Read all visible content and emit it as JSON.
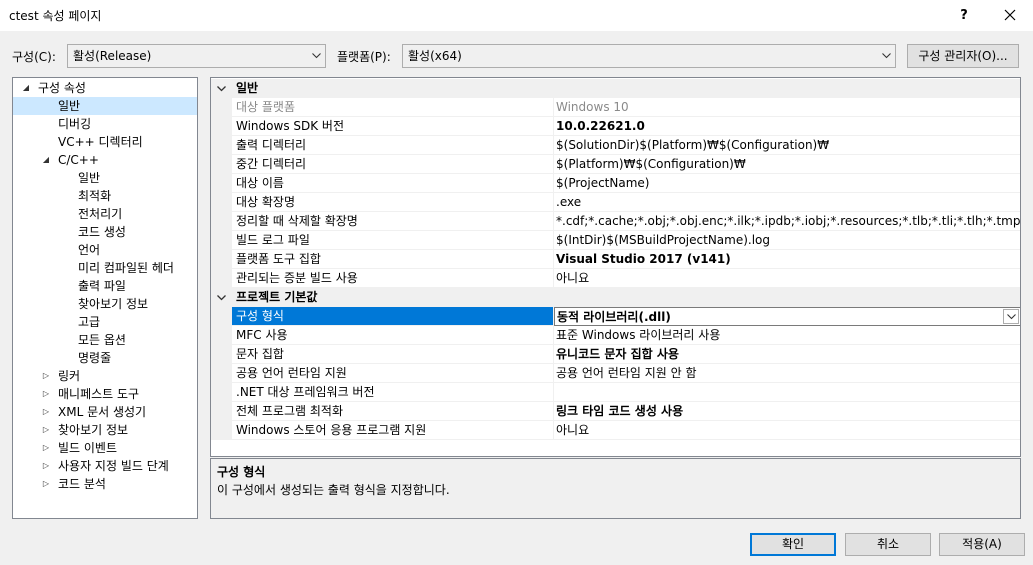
{
  "window": {
    "title": "ctest 속성 페이지",
    "help": "?",
    "close": "✕"
  },
  "top": {
    "config_label": "구성(C):",
    "config_value": "활성(Release)",
    "platform_label": "플랫폼(P):",
    "platform_value": "활성(x64)",
    "config_manager": "구성 관리자(O)..."
  },
  "tree": {
    "items": [
      {
        "label": "구성 속성"
      },
      {
        "label": "일반"
      },
      {
        "label": "디버깅"
      },
      {
        "label": "VC++ 디렉터리"
      },
      {
        "label": "C/C++"
      },
      {
        "label": "일반"
      },
      {
        "label": "최적화"
      },
      {
        "label": "전처리기"
      },
      {
        "label": "코드 생성"
      },
      {
        "label": "언어"
      },
      {
        "label": "미리 컴파일된 헤더"
      },
      {
        "label": "출력 파일"
      },
      {
        "label": "찾아보기 정보"
      },
      {
        "label": "고급"
      },
      {
        "label": "모든 옵션"
      },
      {
        "label": "명령줄"
      },
      {
        "label": "링커"
      },
      {
        "label": "매니페스트 도구"
      },
      {
        "label": "XML 문서 생성기"
      },
      {
        "label": "찾아보기 정보"
      },
      {
        "label": "빌드 이벤트"
      },
      {
        "label": "사용자 지정 빌드 단계"
      },
      {
        "label": "코드 분석"
      }
    ]
  },
  "grid": {
    "categories": [
      {
        "title": "일반"
      },
      {
        "title": "프로젝트 기본값"
      }
    ],
    "general": [
      {
        "name": "대상 플랫폼",
        "value": "Windows 10"
      },
      {
        "name": "Windows SDK 버전",
        "value": "10.0.22621.0"
      },
      {
        "name": "출력 디렉터리",
        "value": "$(SolutionDir)$(Platform)₩$(Configuration)₩"
      },
      {
        "name": "중간 디렉터리",
        "value": "$(Platform)₩$(Configuration)₩"
      },
      {
        "name": "대상 이름",
        "value": "$(ProjectName)"
      },
      {
        "name": "대상 확장명",
        "value": ".exe"
      },
      {
        "name": "정리할 때 삭제할 확장명",
        "value": "*.cdf;*.cache;*.obj;*.obj.enc;*.ilk;*.ipdb;*.iobj;*.resources;*.tlb;*.tli;*.tlh;*.tmp;*.rsp;*.pgc;*.pgd;*.meta"
      },
      {
        "name": "빌드 로그 파일",
        "value": "$(IntDir)$(MSBuildProjectName).log"
      },
      {
        "name": "플랫폼 도구 집합",
        "value": "Visual Studio 2017 (v141)"
      },
      {
        "name": "관리되는 증분 빌드 사용",
        "value": "아니요"
      }
    ],
    "defaults": [
      {
        "name": "구성 형식",
        "value": "동적 라이브러리(.dll)"
      },
      {
        "name": "MFC 사용",
        "value": "표준 Windows 라이브러리 사용"
      },
      {
        "name": "문자 집합",
        "value": "유니코드 문자 집합 사용"
      },
      {
        "name": "공용 언어 런타임 지원",
        "value": "공용 언어 런타임 지원 안 함"
      },
      {
        "name": ".NET 대상 프레임워크 버전",
        "value": ""
      },
      {
        "name": "전체 프로그램 최적화",
        "value": "링크 타임 코드 생성 사용"
      },
      {
        "name": "Windows 스토어 응용 프로그램 지원",
        "value": "아니요"
      }
    ]
  },
  "description": {
    "title": "구성 형식",
    "text": "이 구성에서 생성되는 출력 형식을 지정합니다."
  },
  "buttons": {
    "ok": "확인",
    "cancel": "취소",
    "apply": "적용(A)"
  },
  "colors": {
    "selection": "#0078d7",
    "tree_selection": "#cce8ff",
    "default_button_border": "#0078d7"
  }
}
